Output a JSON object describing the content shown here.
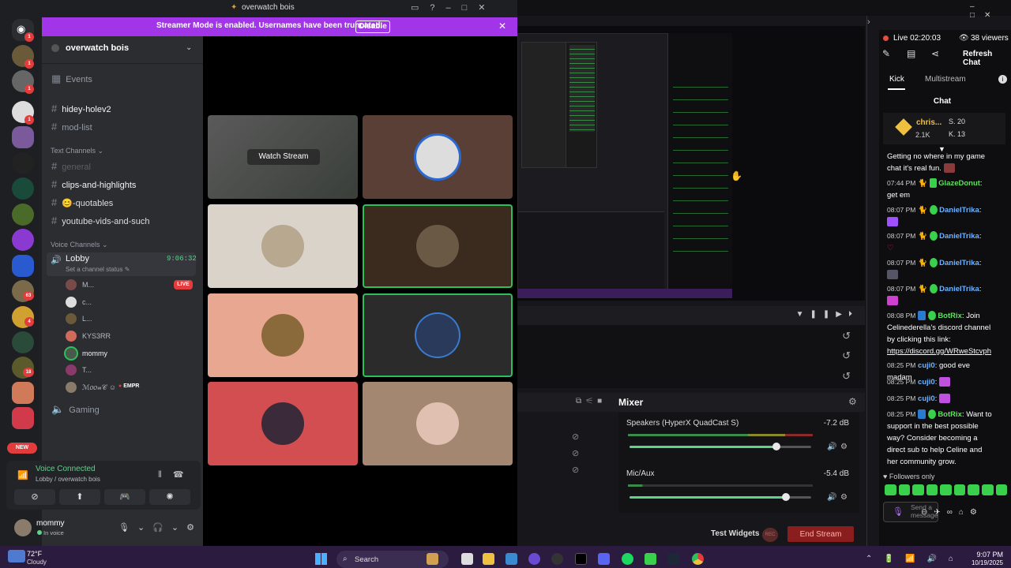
{
  "discord": {
    "window_title": "overwatch bois",
    "banner": {
      "text": "Streamer Mode is enabled. Usernames have been truncated.",
      "disable_label": "Disable"
    },
    "server_name": "overwatch bois",
    "events_label": "Events",
    "top_channels": [
      {
        "name": "hidey-holev2"
      },
      {
        "name": "mod-list"
      }
    ],
    "text_channels_label": "Text Channels",
    "text_channels": [
      {
        "name": "general"
      },
      {
        "name": "clips-and-highlights"
      },
      {
        "name": "😊-quotables"
      },
      {
        "name": "youtube-vids-and-such"
      }
    ],
    "voice_channels_label": "Voice Channels",
    "lobby": {
      "name": "Lobby",
      "time": "9:06:32",
      "status": "Set a channel status ✎"
    },
    "voice_users": [
      {
        "name": "M..."
      },
      {
        "name": "c..."
      },
      {
        "name": "L..."
      },
      {
        "name": "KYS3RR"
      },
      {
        "name": "mommy"
      },
      {
        "name": "T..."
      },
      {
        "name": "ℳ𝑜𝑜𝓃𝒞 ☺"
      }
    ],
    "live_label": "LIVE",
    "empr_label": "EMPR",
    "gaming_label": "Gaming",
    "guild_badges": [
      "1",
      "1",
      "1",
      "1",
      "63",
      "4",
      "18"
    ],
    "new_label": "NEW",
    "voice_connected": {
      "title": "Voice Connected",
      "subtitle": "Lobby / overwatch bois"
    },
    "user": {
      "name": "mommy",
      "status": "In voice"
    },
    "watch_stream_label": "Watch Stream",
    "guild_icons": [
      "discord-home-icon",
      "server-icon"
    ]
  },
  "obs": {
    "mixer_title": "Mixer",
    "channels": [
      {
        "name": "Speakers (HyperX QuadCast S)",
        "db": "-7.2 dB",
        "level": 0.81
      },
      {
        "name": "Mic/Aux",
        "db": "-5.4 dB",
        "level": 0.86
      }
    ],
    "test_widgets_label": "Test Widgets",
    "rec_label": "REC",
    "end_stream_label": "End Stream"
  },
  "chat": {
    "live_label": "Live 02:20:03",
    "viewers_label": "38 viewers",
    "refresh_label": "Refresh Chat",
    "tabs": [
      {
        "label": "Kick"
      },
      {
        "label": "Multistream"
      }
    ],
    "heading": "Chat",
    "pinned": {
      "name": "chris...",
      "sub": "2.1K",
      "s_label": "S. 20",
      "k_label": "K. 13"
    },
    "messages": [
      {
        "time": "",
        "user": "",
        "text": "Getting no where in my game chat it's real fun."
      },
      {
        "time": "07:44 PM",
        "user": "GlazeDonut",
        "text": ": get em"
      },
      {
        "time": "08:07 PM",
        "user": "DanielTrika",
        "text": ":"
      },
      {
        "time": "08:07 PM",
        "user": "DanielTrika",
        "text": ":"
      },
      {
        "time": "08:07 PM",
        "user": "DanielTrika",
        "text": ":"
      },
      {
        "time": "08:07 PM",
        "user": "DanielTrika",
        "text": ":"
      },
      {
        "time": "08:08 PM",
        "user": "BotRix",
        "text": ": Join Celinederella's discord channel by clicking this link:",
        "link": "https://discord.gg/WRweStcvph"
      },
      {
        "time": "08:25 PM",
        "user": "cuji0",
        "text": ": good eve madam"
      },
      {
        "time": "08:25 PM",
        "user": "cuji0",
        "text": ":"
      },
      {
        "time": "08:25 PM",
        "user": "cuji0",
        "text": ":"
      },
      {
        "time": "08:25 PM",
        "user": "BotRix",
        "text": ": Want to support in the best possible way? Consider becoming a direct sub to help Celine and her community grow."
      }
    ],
    "followers_only": "♥ Followers only",
    "input_placeholder": "Send a message"
  },
  "taskbar": {
    "temp": "72°F",
    "condition": "Cloudy",
    "search_label": "Search",
    "time": "9:07 PM",
    "date": "10/19/2025"
  },
  "colors": {
    "accent_purple": "#a235e8",
    "voice_green": "#5fd28a",
    "live_red": "#e23c3c",
    "kick_green": "#39d04b"
  }
}
